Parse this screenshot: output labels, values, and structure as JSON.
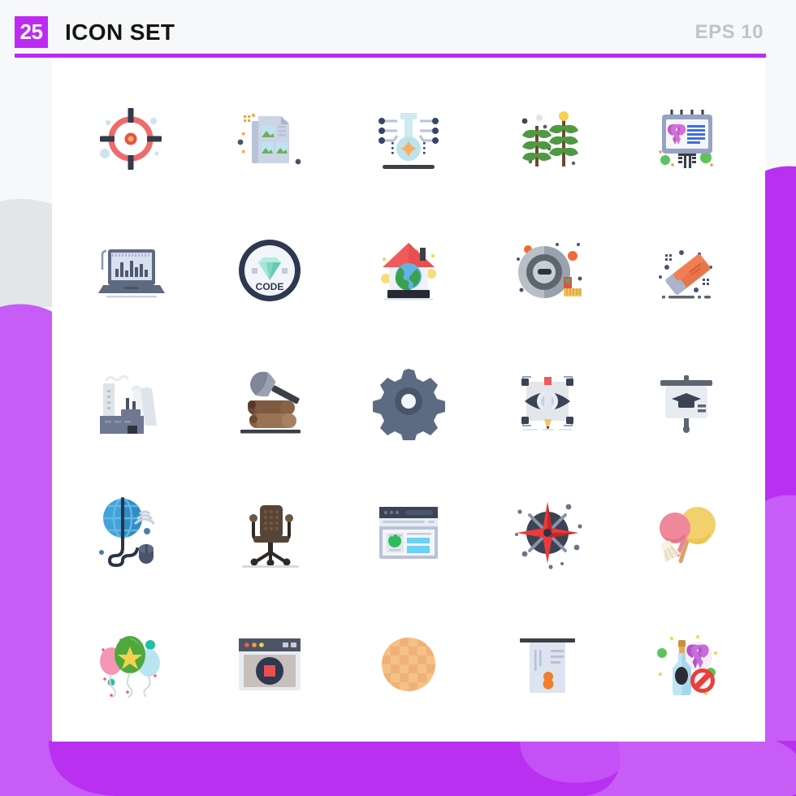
{
  "header": {
    "count_badge": "25",
    "title": "ICON SET",
    "format_label": "EPS 10"
  },
  "colors": {
    "accent_purple": "#bd2bf2",
    "blob_purple_light": "#c75cf7",
    "blob_purple_dark": "#b930f0",
    "blob_gray": "#e2e6e8",
    "page_background": "#f7f8fa",
    "sheet_background": "#ffffff",
    "title_text": "#141414",
    "format_text": "#bfc3ca",
    "badge_text": "#ffffff"
  },
  "icons": [
    {
      "row": 1,
      "col": 1,
      "name": "target-icon",
      "label": "Target"
    },
    {
      "row": 1,
      "col": 2,
      "name": "document-image-icon",
      "label": "Image Document"
    },
    {
      "row": 1,
      "col": 3,
      "name": "flask-network-icon",
      "label": "Science Flask"
    },
    {
      "row": 1,
      "col": 4,
      "name": "plants-icon",
      "label": "Plants"
    },
    {
      "row": 1,
      "col": 5,
      "name": "billboard-ribbon-icon",
      "label": "Awareness Billboard"
    },
    {
      "row": 2,
      "col": 1,
      "name": "laptop-chart-icon",
      "label": "Laptop Analytics"
    },
    {
      "row": 2,
      "col": 2,
      "name": "code-badge-icon",
      "label": "Code Badge"
    },
    {
      "row": 2,
      "col": 3,
      "name": "eco-house-icon",
      "label": "Eco House"
    },
    {
      "row": 2,
      "col": 4,
      "name": "tape-measure-icon",
      "label": "Tape Measure"
    },
    {
      "row": 2,
      "col": 5,
      "name": "eraser-icon",
      "label": "Eraser"
    },
    {
      "row": 3,
      "col": 1,
      "name": "factory-icon",
      "label": "Factory"
    },
    {
      "row": 3,
      "col": 2,
      "name": "axe-logs-icon",
      "label": "Axe and Logs"
    },
    {
      "row": 3,
      "col": 3,
      "name": "gear-icon",
      "label": "Settings Gear"
    },
    {
      "row": 3,
      "col": 4,
      "name": "eye-pencil-icon",
      "label": "Design Preview"
    },
    {
      "row": 3,
      "col": 5,
      "name": "education-board-icon",
      "label": "Education Board"
    },
    {
      "row": 4,
      "col": 1,
      "name": "globe-mouse-icon",
      "label": "Global Network"
    },
    {
      "row": 4,
      "col": 2,
      "name": "office-chair-icon",
      "label": "Office Chair"
    },
    {
      "row": 4,
      "col": 3,
      "name": "browser-window-icon",
      "label": "Browser Window"
    },
    {
      "row": 4,
      "col": 4,
      "name": "compass-rose-icon",
      "label": "Compass"
    },
    {
      "row": 4,
      "col": 5,
      "name": "lollipops-icon",
      "label": "Lollipops"
    },
    {
      "row": 5,
      "col": 1,
      "name": "balloons-icon",
      "label": "Balloons"
    },
    {
      "row": 5,
      "col": 2,
      "name": "record-window-icon",
      "label": "Screen Record"
    },
    {
      "row": 5,
      "col": 3,
      "name": "waffle-icon",
      "label": "Waffle"
    },
    {
      "row": 5,
      "col": 4,
      "name": "certificate-icon",
      "label": "Certificate"
    },
    {
      "row": 5,
      "col": 5,
      "name": "no-alcohol-icon",
      "label": "No Alcohol"
    }
  ],
  "code_badge_text": "CODE"
}
